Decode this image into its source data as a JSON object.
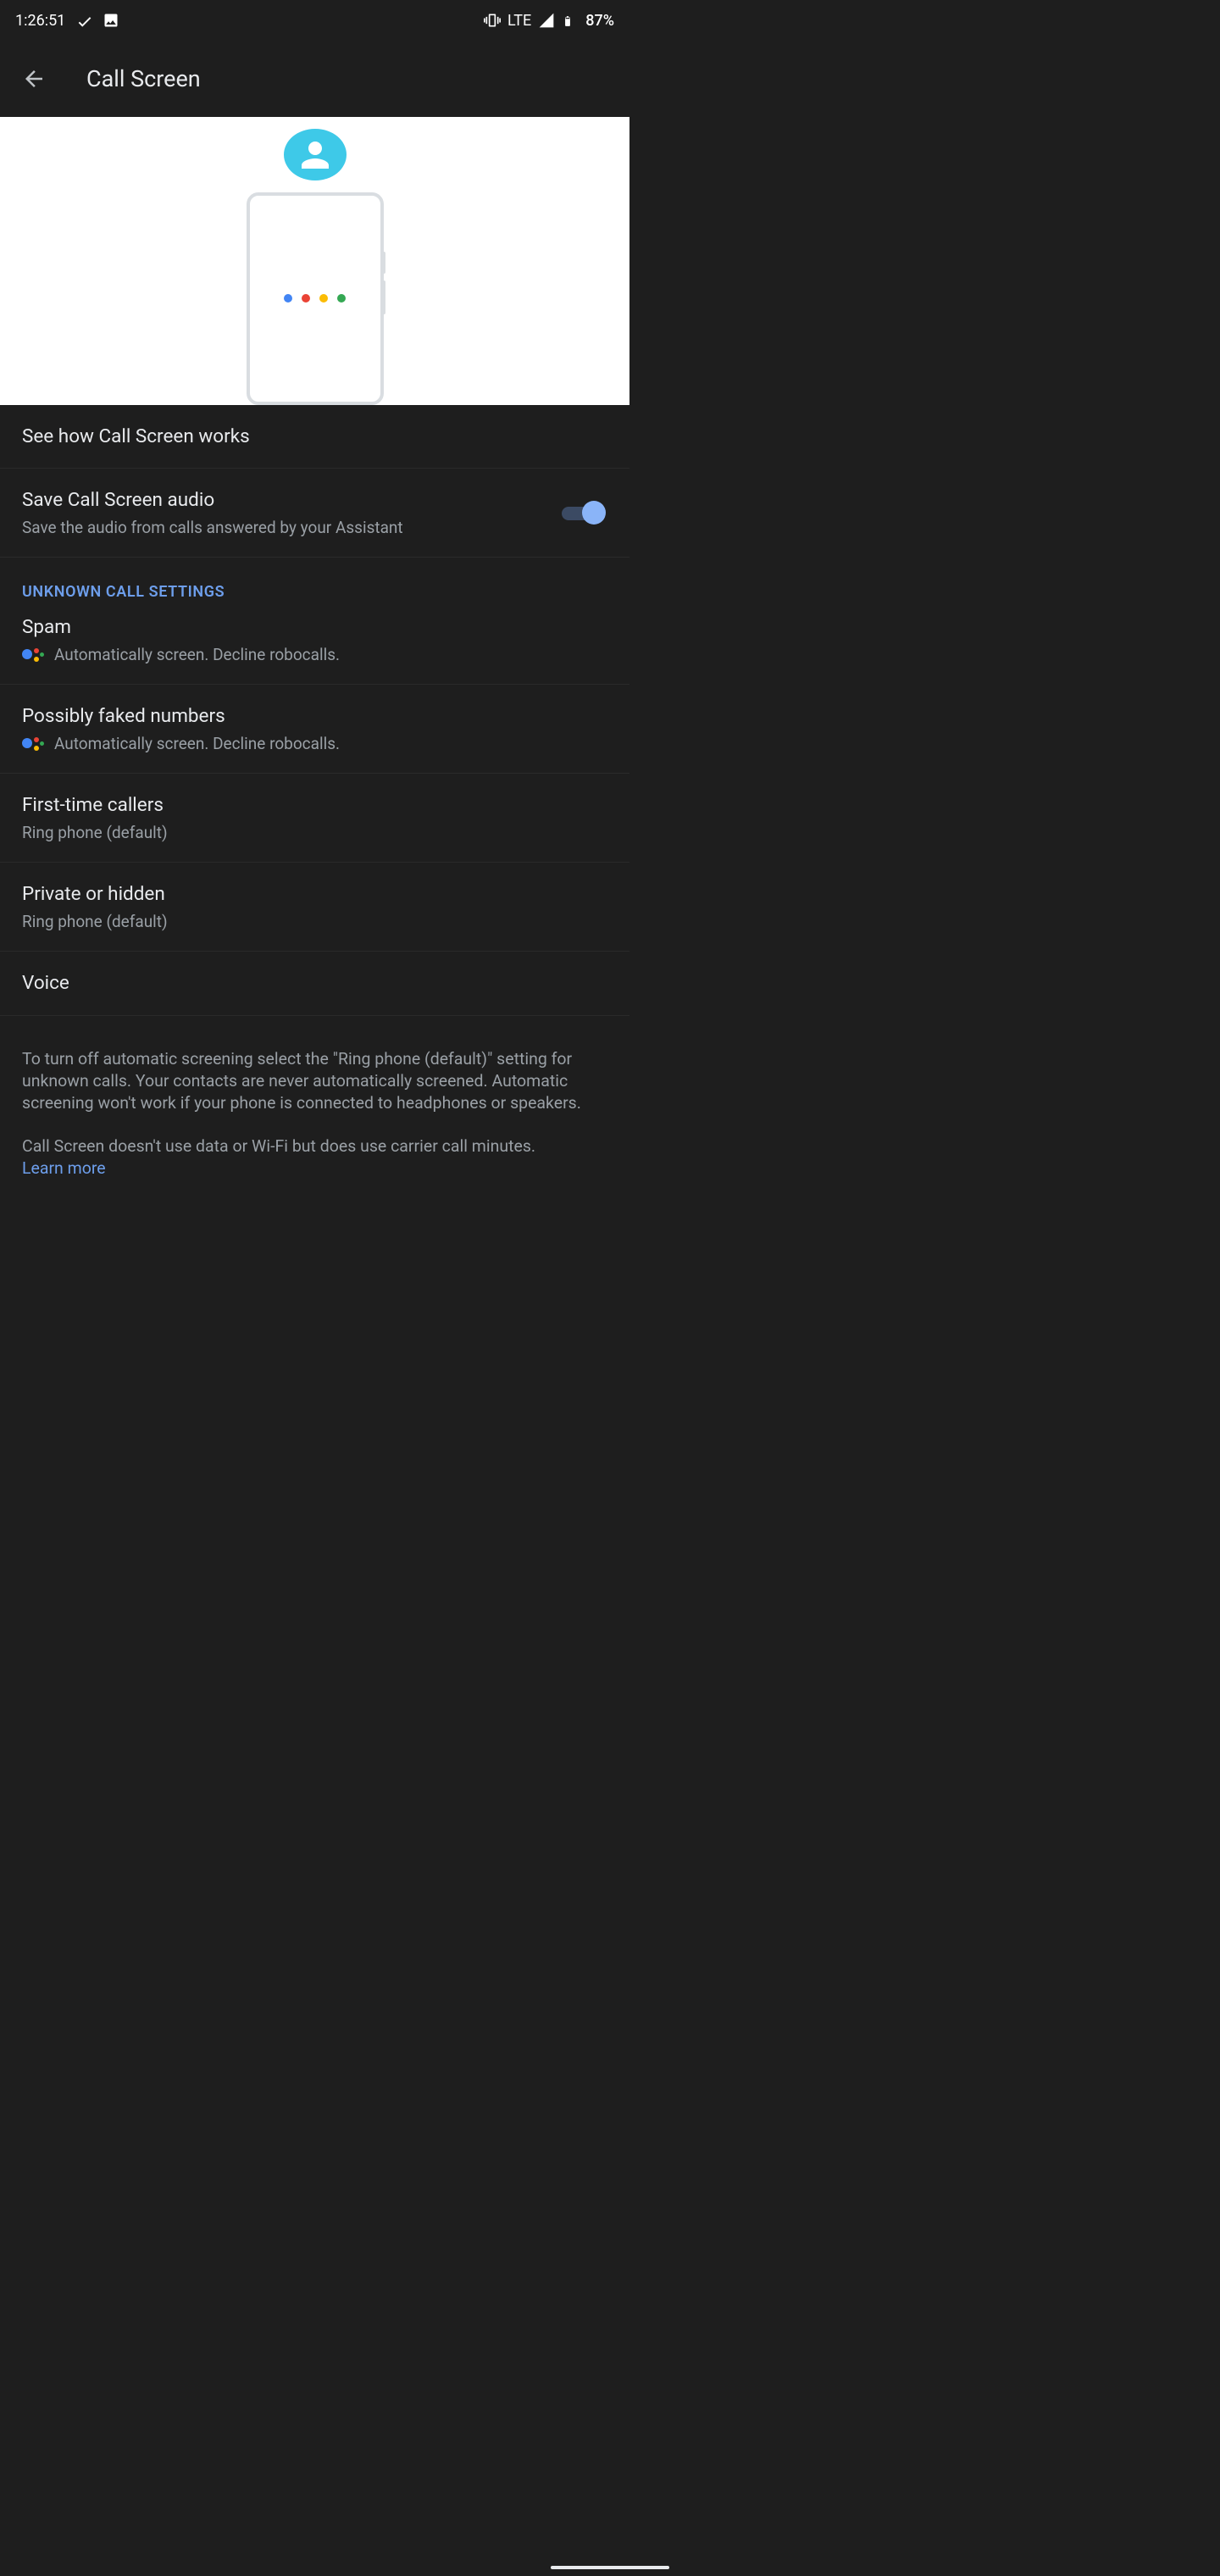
{
  "status": {
    "time": "1:26:51",
    "lte": "LTE",
    "battery_pct": "87%"
  },
  "appbar": {
    "title": "Call Screen"
  },
  "items": {
    "see_how": {
      "title": "See how Call Screen works"
    },
    "save_audio": {
      "title": "Save Call Screen audio",
      "sub": "Save the audio from calls answered by your Assistant",
      "enabled": true
    },
    "section_unknown": "UNKNOWN CALL SETTINGS",
    "spam": {
      "title": "Spam",
      "sub": "Automatically screen. Decline robocalls."
    },
    "faked": {
      "title": "Possibly faked numbers",
      "sub": "Automatically screen. Decline robocalls."
    },
    "first_time": {
      "title": "First-time callers",
      "sub": "Ring phone (default)"
    },
    "private": {
      "title": "Private or hidden",
      "sub": "Ring phone (default)"
    },
    "voice": {
      "title": "Voice"
    }
  },
  "footer": {
    "para1": "To turn off automatic screening select the \"Ring phone (default)\" setting for unknown calls. Your contacts are never automatically screened. Automatic screening won't work if your phone is connected to headphones or speakers.",
    "para2": "Call Screen doesn't use data or Wi-Fi but does use carrier call minutes.",
    "learn_more": "Learn more"
  }
}
